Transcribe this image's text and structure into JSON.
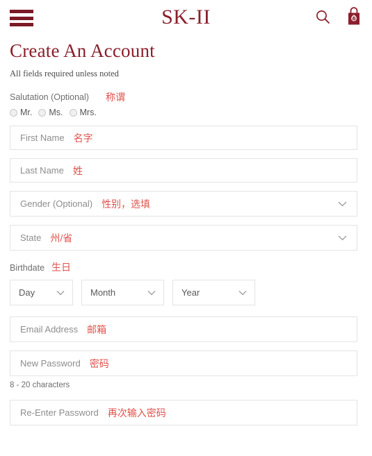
{
  "header": {
    "menu_icon": "hamburger-menu-icon",
    "brand": "SK-II",
    "search_icon": "search-icon",
    "bag_icon": "shopping-bag-icon",
    "bag_count": "0"
  },
  "page": {
    "title": "Create An Account",
    "subnote": "All fields required unless noted"
  },
  "salutation": {
    "label": "Salutation (Optional)",
    "annotation": "称谓",
    "options": [
      {
        "label": "Mr."
      },
      {
        "label": "Ms."
      },
      {
        "label": "Mrs."
      }
    ]
  },
  "fields": {
    "first_name": {
      "placeholder": "First Name",
      "annotation": "名字"
    },
    "last_name": {
      "placeholder": "Last Name",
      "annotation": "姓"
    },
    "gender": {
      "placeholder": "Gender (Optional)",
      "annotation": "性别，选填"
    },
    "state": {
      "placeholder": "State",
      "annotation": "州/省"
    },
    "email": {
      "placeholder": "Email Address",
      "annotation": "邮箱"
    },
    "new_password": {
      "placeholder": "New Password",
      "annotation": "密码",
      "help": "8 - 20 characters"
    },
    "reenter_password": {
      "placeholder": "Re-Enter Password",
      "annotation": "再次输入密码"
    }
  },
  "birthdate": {
    "label": "Birthdate",
    "annotation": "生日",
    "day": "Day",
    "month": "Month",
    "year": "Year"
  },
  "colors": {
    "brand_red": "#8a1f2b",
    "annotation_red": "#e0514b",
    "border_gray": "#e3e3e3",
    "placeholder_gray": "#8d8d8d"
  }
}
